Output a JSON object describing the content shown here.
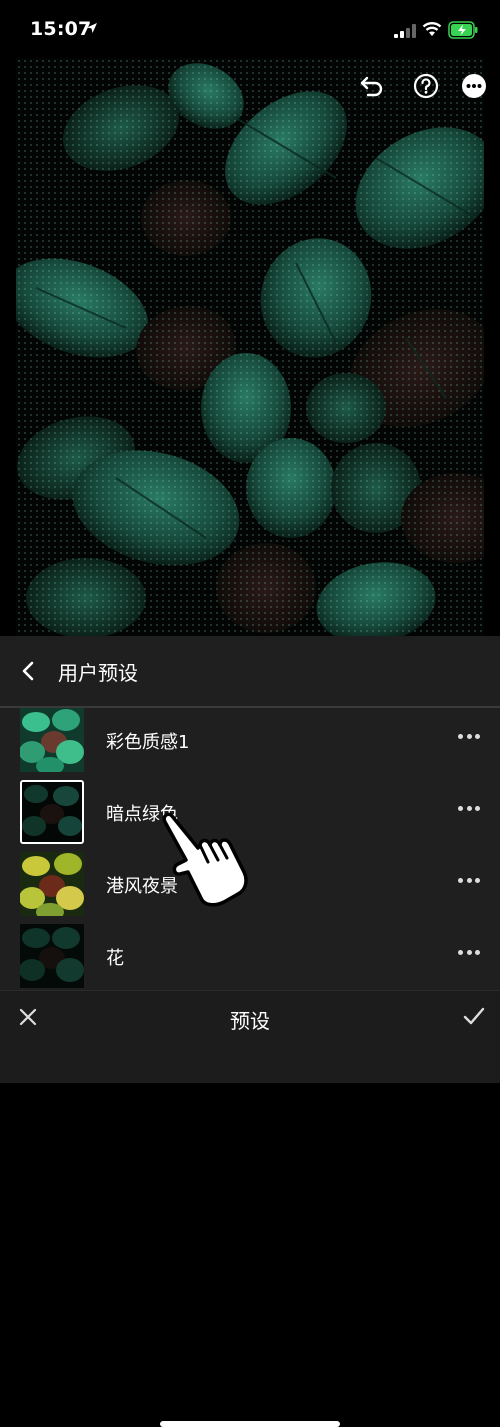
{
  "status_bar": {
    "time": "15:07"
  },
  "icons": {
    "location": "location-arrow-icon",
    "signal": "cellular-signal-icon",
    "wifi": "wifi-icon",
    "battery": "battery-charging-icon",
    "undo": "undo-icon",
    "help": "help-circle-icon",
    "more": "more-horizontal-icon",
    "back": "chevron-left-icon",
    "close": "close-icon",
    "confirm": "checkmark-icon",
    "cursor": "pointing-hand-icon"
  },
  "colors": {
    "accent_battery": "#39d353",
    "panel_bg": "#1f1f1f",
    "leaf": "#1f5e4b"
  },
  "panel": {
    "title": "用户预设",
    "presets": [
      {
        "label": "彩色质感1",
        "selected": false
      },
      {
        "label": "暗点绿色",
        "selected": true
      },
      {
        "label": "港风夜景",
        "selected": false
      },
      {
        "label": "花",
        "selected": false
      }
    ]
  },
  "bottom_bar": {
    "title": "预设"
  }
}
